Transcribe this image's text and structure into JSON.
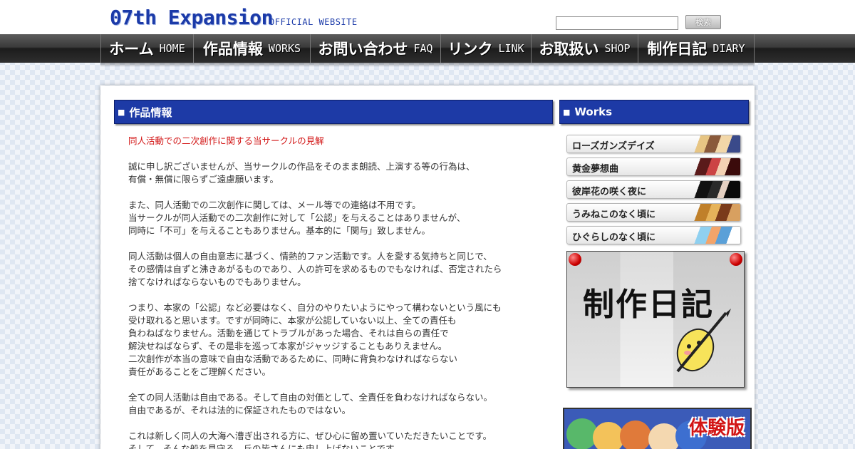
{
  "header": {
    "logo": "07th Expansion",
    "logo_sub": "OFFICIAL WEBSITE",
    "search_placeholder": "",
    "search_button": "検索"
  },
  "nav": [
    {
      "jp": "ホーム",
      "en": "HOME"
    },
    {
      "jp": "作品情報",
      "en": "WORKS"
    },
    {
      "jp": "お問い合わせ",
      "en": "FAQ"
    },
    {
      "jp": "リンク",
      "en": "LINK"
    },
    {
      "jp": "お取扱い",
      "en": "SHOP"
    },
    {
      "jp": "制作日記",
      "en": "DIARY"
    }
  ],
  "main": {
    "section_title": "作品情報",
    "heading": "同人活動での二次創作に関する当サークルの見解",
    "paragraphs": [
      [
        "誠に申し訳ございませんが、当サークルの作品をそのまま朗読、上演する等の行為は、",
        "有償・無償に限らずご遠慮願います。"
      ],
      [
        "また、同人活動での二次創作に関しては、メール等での連絡は不用です。",
        "当サークルが同人活動での二次創作に対して「公認」を与えることはありませんが、",
        "同時に「不可」を与えることもありません。基本的に「関与」致しません。"
      ],
      [
        "同人活動は個人の自由意志に基づく、情熱的ファン活動です。人を愛する気持ちと同じで、",
        "その感情は自ずと沸きあがるものであり、人の許可を求めるものでもなければ、否定されたら",
        "捨てなければならないものでもありません。"
      ],
      [
        "つまり、本家の「公認」など必要はなく、自分のやりたいようにやって構わないという風にも",
        "受け取れると思います。ですが同時に、本家が公認していない以上、全ての責任も",
        "負わねばなりません。活動を通じてトラブルがあった場合、それは自らの責任で",
        "解決せねばならず、その是非を巡って本家がジャッジすることもありえません。",
        "二次創作が本当の意味で自由な活動であるために、同時に背負わなければならない",
        "責任があることをご理解ください。"
      ],
      [
        "全ての同人活動は自由である。そして自由の対価として、全責任を負わなければならない。",
        "自由であるが、それは法的に保証されたものではない。"
      ],
      [
        "これは新しく同人の大海へ漕ぎ出される方に、ぜひ心に留め置いていただきたいことです。",
        "そして、そんな船を見守る、丘の皆さんにも申し上げないことです。"
      ]
    ]
  },
  "sidebar": {
    "section_title": "Works",
    "works": [
      {
        "label": "ローズガンズデイズ"
      },
      {
        "label": "黄金夢想曲"
      },
      {
        "label": "彼岸花の咲く夜に"
      },
      {
        "label": "うみねこのなく頃に"
      },
      {
        "label": "ひぐらしのなく頃に"
      }
    ],
    "diary_banner": "制作日記",
    "trial_banner": "体験版"
  },
  "colors": {
    "accent_blue": "#1d3aa6",
    "heading_red": "#d21515",
    "nav_dark": "#2e2e2e"
  }
}
